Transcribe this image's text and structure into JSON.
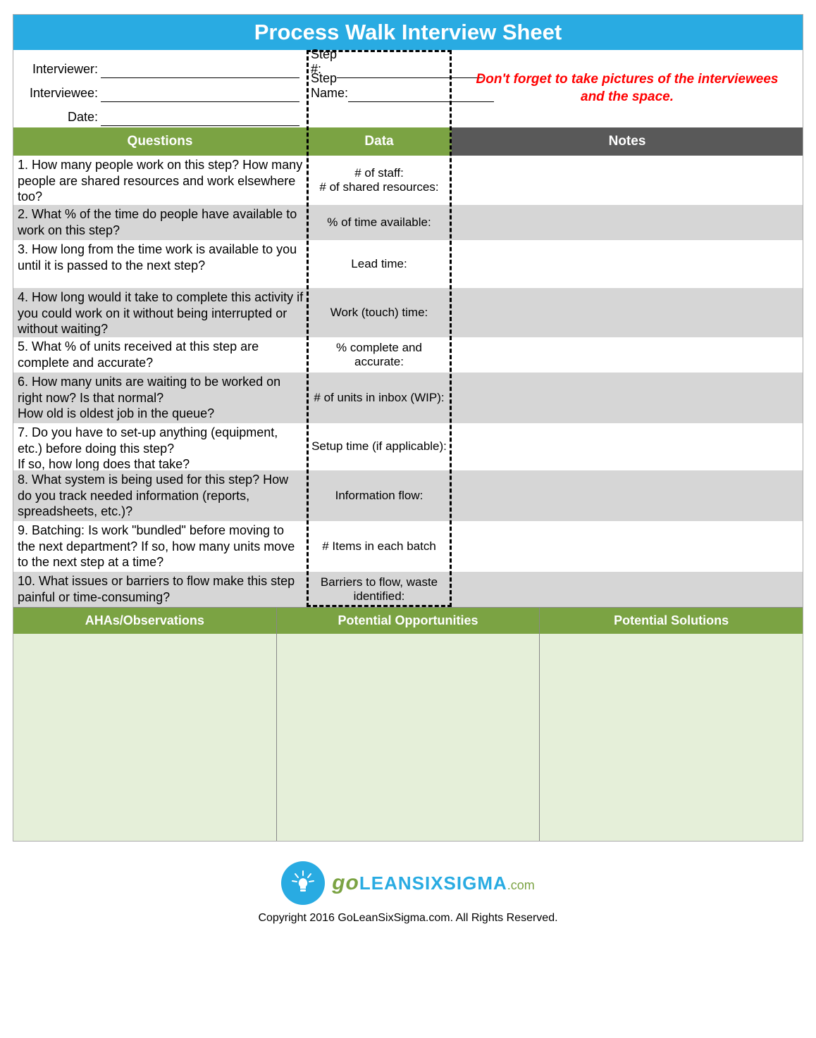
{
  "title": "Process Walk Interview Sheet",
  "meta": {
    "interviewer_label": "Interviewer:",
    "interviewee_label": "Interviewee:",
    "date_label": "Date:",
    "step_no_label": "Step #:",
    "step_name_label": "Step Name:",
    "reminder": "Don't forget to take pictures of the interviewees and the space."
  },
  "headers": {
    "questions": "Questions",
    "data": "Data",
    "notes": "Notes"
  },
  "rows": [
    {
      "q": "1. How many people work on this step? How many people are shared resources and work elsewhere too?",
      "d": "# of staff:\n# of shared resources:"
    },
    {
      "q": "2. What % of the time do people have available to work on this  step?",
      "d": "% of time available:"
    },
    {
      "q": "3. How long from the time work is available to you until it is passed to the next step?",
      "d": "Lead time:"
    },
    {
      "q": "4. How long would it take to complete this activity if you could work on it without being interrupted or without waiting?",
      "d": "Work (touch) time:"
    },
    {
      "q": "5. What % of units received at this step are complete and accurate?",
      "d": "% complete and accurate:"
    },
    {
      "q": "6. How many units are waiting to be worked on right now? Is that normal?\nHow old is oldest job in the queue?",
      "d": "# of units in inbox (WIP):"
    },
    {
      "q": "7. Do you have to set-up anything (equipment, etc.) before doing this step?\nIf so, how long does that take?",
      "d": "Setup time (if applicable):"
    },
    {
      "q": "8. What system is being used for this step? How do you track needed information (reports, spreadsheets, etc.)?",
      "d": "Information flow:"
    },
    {
      "q": "9. Batching: Is work \"bundled\" before moving to the next department? If so, how many units move to the next step at a time?",
      "d": "# Items in each batch"
    },
    {
      "q": "10. What issues or barriers to flow make this step painful or time-consuming?",
      "d": "Barriers to flow, waste identified:"
    }
  ],
  "panel": {
    "ahas": "AHAs/Observations",
    "opps": "Potential Opportunities",
    "sols": "Potential Solutions"
  },
  "logo": {
    "go": "go",
    "lean": "LEANSIXSIGMA",
    "com": ".com"
  },
  "copyright": "Copyright 2016 GoLeanSixSigma.com. All Rights Reserved."
}
